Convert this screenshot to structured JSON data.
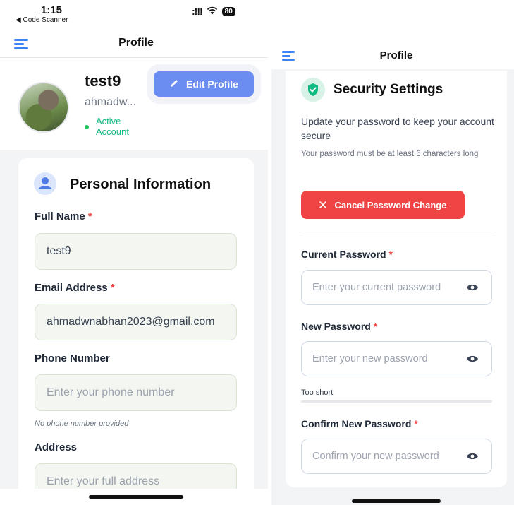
{
  "left_screen": {
    "status_bar": {
      "time": "1:15",
      "back_app": "◀ Code Scanner",
      "signal": ":!!!",
      "battery": "80"
    },
    "nav": {
      "title": "Profile"
    },
    "profile": {
      "username": "test9",
      "email_truncated": "ahmadw...",
      "status": "Active Account",
      "edit_button": "Edit Profile"
    },
    "personal_info": {
      "title": "Personal Information",
      "fields": [
        {
          "label": "Full Name",
          "required": true,
          "value": "test9",
          "placeholder": ""
        },
        {
          "label": "Email Address",
          "required": true,
          "value": "ahmadwnabhan2023@gmail.com",
          "placeholder": ""
        },
        {
          "label": "Phone Number",
          "required": false,
          "value": "",
          "placeholder": "Enter your phone number",
          "hint": "No phone number provided"
        },
        {
          "label": "Address",
          "required": false,
          "value": "",
          "placeholder": "Enter your full address"
        }
      ],
      "required_mark": "*"
    }
  },
  "right_screen": {
    "nav": {
      "title": "Profile"
    },
    "security": {
      "title": "Security Settings",
      "description": "Update your password to keep your account secure",
      "requirement": "Your password must be at least 6 characters long",
      "cancel_button": "Cancel Password Change",
      "fields": [
        {
          "label": "Current Password",
          "required": true,
          "placeholder": "Enter your current password"
        },
        {
          "label": "New Password",
          "required": true,
          "placeholder": "Enter your new password"
        },
        {
          "label": "Confirm New Password",
          "required": true,
          "placeholder": "Confirm your new password"
        }
      ],
      "strength_text": "Too short",
      "strength_fraction": 0
    }
  },
  "colors": {
    "accent_blue": "#3b82f6",
    "edit_button": "#6b8cf0",
    "danger": "#ee4444",
    "success": "#10b981",
    "required": "#ef4444"
  },
  "icons": {
    "menu": "hamburger-menu-icon",
    "edit": "pencil-icon",
    "personal": "user-icon",
    "security": "shield-check-icon",
    "cancel": "close-x-icon",
    "eye": "eye-icon"
  }
}
